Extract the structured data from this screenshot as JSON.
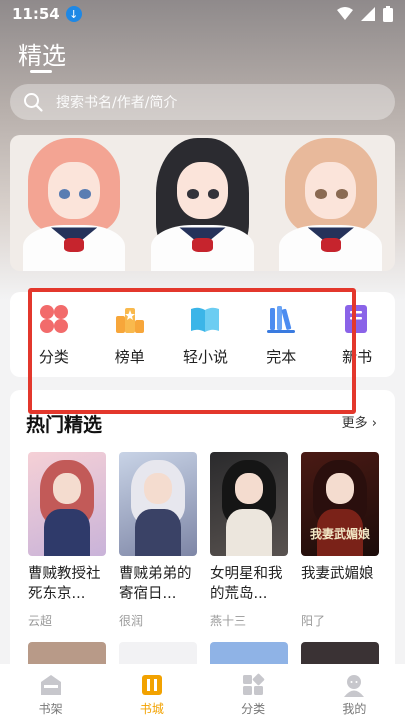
{
  "status_bar": {
    "time": "11:54",
    "icons": [
      "download-icon",
      "wifi-icon",
      "signal-icon",
      "battery-icon"
    ]
  },
  "header": {
    "title": "精选"
  },
  "search": {
    "placeholder": "搜索书名/作者/简介"
  },
  "categories": [
    {
      "label": "分类",
      "icon": "category-icon",
      "color": "#f26b6b"
    },
    {
      "label": "榜单",
      "icon": "ranking-icon",
      "color": "#f7a63a"
    },
    {
      "label": "轻小说",
      "icon": "light-novel-icon",
      "color": "#3bb5e8"
    },
    {
      "label": "完本",
      "icon": "finished-icon",
      "color": "#4c8cf0"
    },
    {
      "label": "新书",
      "icon": "new-book-icon",
      "color": "#8a63e8"
    }
  ],
  "hot": {
    "title": "热门精选",
    "more": "更多",
    "books": [
      {
        "title": "曹贼教授社死东京...",
        "author": "云超"
      },
      {
        "title": "曹贼弟弟的寄宿日...",
        "author": "很润"
      },
      {
        "title": "女明星和我的荒岛...",
        "author": "燕十三"
      },
      {
        "title": "我妻武媚娘",
        "author": "阳了",
        "cover_text": "我妻武媚娘"
      }
    ]
  },
  "tabs": [
    {
      "label": "书架",
      "icon": "bookshelf-icon",
      "active": false
    },
    {
      "label": "书城",
      "icon": "bookstore-icon",
      "active": true
    },
    {
      "label": "分类",
      "icon": "category-grid-icon",
      "active": false
    },
    {
      "label": "我的",
      "icon": "profile-icon",
      "active": false
    }
  ],
  "colors": {
    "accent": "#f2a200",
    "highlight_box": "#e3372c"
  }
}
